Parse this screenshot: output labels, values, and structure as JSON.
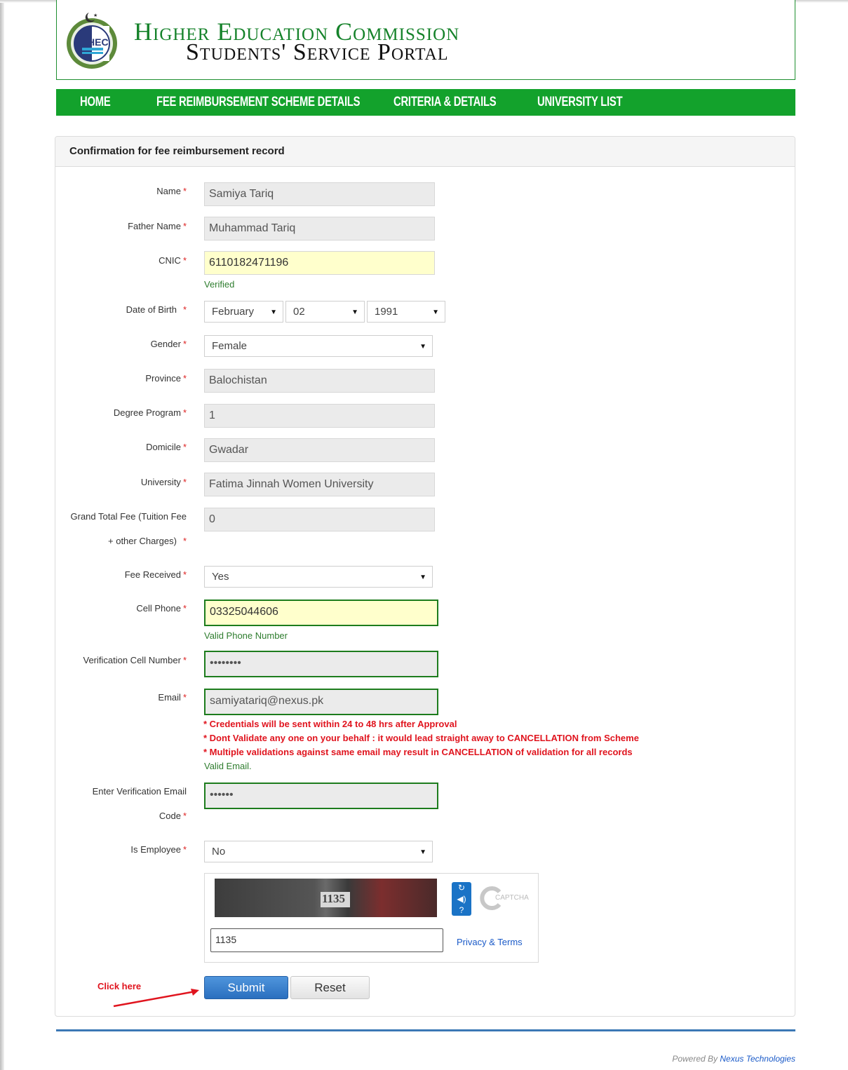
{
  "header": {
    "title_line1": "Higher Education Commission",
    "title_line2": "Students' Service Portal",
    "logo_text": "HEC"
  },
  "nav": {
    "home": "HOME",
    "fee_scheme": "FEE REIMBURSEMENT SCHEME DETAILS",
    "criteria": "CRITERIA & DETAILS",
    "university_list": "UNIVERSITY LIST"
  },
  "panel": {
    "heading": "Confirmation for fee reimbursement record"
  },
  "form": {
    "required_mark": "*",
    "name": {
      "label": "Name",
      "value": "Samiya Tariq"
    },
    "father_name": {
      "label": "Father Name",
      "value": "Muhammad Tariq"
    },
    "cnic": {
      "label": "CNIC",
      "value": "6110182471196",
      "status": "Verified"
    },
    "dob": {
      "label": "Date of Birth",
      "month": "February",
      "day": "02",
      "year": "1991"
    },
    "gender": {
      "label": "Gender",
      "value": "Female"
    },
    "province": {
      "label": "Province",
      "value": "Balochistan"
    },
    "degree_program": {
      "label": "Degree Program",
      "value": "1"
    },
    "domicile": {
      "label": "Domicile",
      "value": "Gwadar"
    },
    "university": {
      "label": "University",
      "value": "Fatima Jinnah Women University"
    },
    "grand_total": {
      "label_line1": "Grand Total Fee (Tuition Fee",
      "label_line2": "+ other Charges)",
      "value": "0"
    },
    "fee_received": {
      "label": "Fee Received",
      "value": "Yes"
    },
    "cell_phone": {
      "label": "Cell Phone",
      "value": "03325044606",
      "status": "Valid Phone Number"
    },
    "verification_cell": {
      "label": "Verification Cell Number",
      "value": "••••••••"
    },
    "email": {
      "label": "Email",
      "value": "samiyatariq@nexus.pk",
      "warning1": "* Credentials will be sent within 24 to 48 hrs after Approval",
      "warning2": "* Dont Validate any one on your behalf : it would lead straight away to CANCELLATION from Scheme",
      "warning3": "* Multiple validations against same email may result in CANCELLATION of validation for all records",
      "status": "Valid Email."
    },
    "verification_email": {
      "label_line1": "Enter Verification Email",
      "label_line2": "Code",
      "value": "••••••"
    },
    "is_employee": {
      "label": "Is Employee",
      "value": "No"
    }
  },
  "captcha": {
    "image_text": "1135",
    "input_value": "1135",
    "brand": "CAPTCHA",
    "privacy_link": "Privacy & Terms"
  },
  "actions": {
    "submit": "Submit",
    "reset": "Reset",
    "annotation": "Click here"
  },
  "footer": {
    "powered_by": "Powered By",
    "company": "Nexus Technologies"
  },
  "colors": {
    "brand_green": "#13a22c",
    "title_green": "#15822a",
    "warning_red": "#e0141e",
    "submit_blue": "#2a6fbf"
  }
}
